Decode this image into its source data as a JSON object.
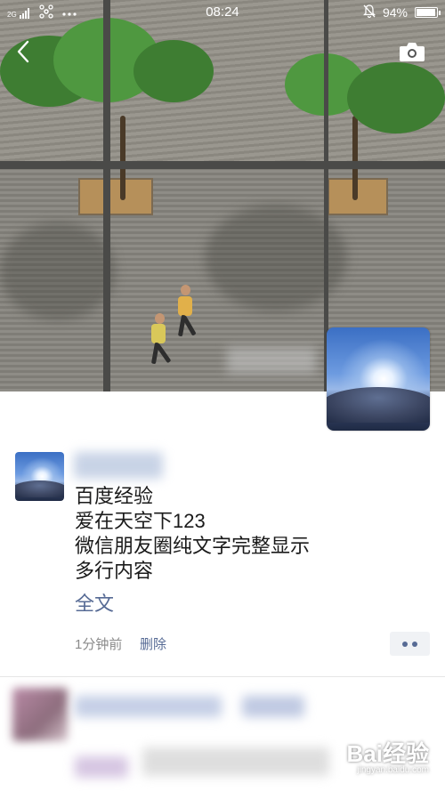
{
  "status_bar": {
    "carrier_signal": "2G",
    "time": "08:24",
    "battery_percent": "94%",
    "battery_level": 0.94,
    "icons": [
      "signal-icon",
      "carrier-logo-icon",
      "more-dots-icon",
      "mute-bell-icon",
      "battery-icon"
    ]
  },
  "nav": {
    "back_icon": "chevron-left-icon",
    "camera_icon": "camera-icon"
  },
  "post": {
    "lines": [
      "百度经验",
      "爱在天空下123",
      "微信朋友圈纯文字完整显示",
      "多行内容"
    ],
    "full_text_link": "全文",
    "time": "1分钟前",
    "delete_label": "删除",
    "more_icon": "more-dots-icon"
  },
  "watermark": {
    "brand": "Bai经验",
    "url": "jingyan.baidu.com"
  },
  "colors": {
    "link": "#576b95",
    "meta_gray": "#8a8a8a",
    "text": "#1a1a1a"
  }
}
